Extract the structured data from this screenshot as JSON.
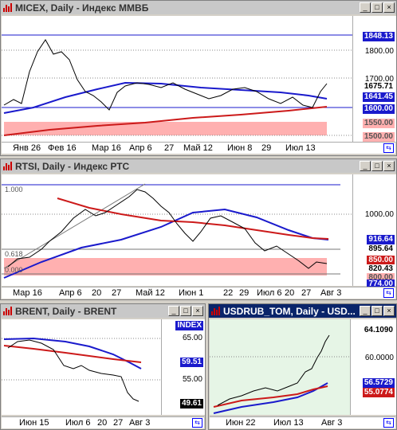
{
  "micex": {
    "title": "MICEX, Daily - Индекс ММВБ",
    "y_ticks": [
      "1800.00",
      "1700.00"
    ],
    "tags": [
      "1848.13",
      "1675.71",
      "1641.45",
      "1600.00",
      "1550.00",
      "1500.00"
    ],
    "x_ticks": [
      "Янв 26",
      "Фев 16",
      "Мар 16",
      "Апр 6",
      "27",
      "Май 12",
      "Июн 8",
      "29",
      "Июл 13"
    ]
  },
  "rtsi": {
    "title": "RTSI, Daily - Индекс РТС",
    "y_ticks": [
      "1000.00"
    ],
    "tags": [
      "916.64",
      "895.64",
      "850.00",
      "820.43",
      "800.00",
      "774.00"
    ],
    "fib": [
      "1.000",
      "0.618",
      "0.000"
    ],
    "x_ticks": [
      "Мар 16",
      "Апр 6",
      "20",
      "27",
      "Май 12",
      "Июн 1",
      "22",
      "29",
      "Июл 6",
      "20",
      "27",
      "Авг 3"
    ]
  },
  "brent": {
    "title": "BRENT, Daily - BRENT",
    "index_label": "INDEX",
    "y_ticks": [
      "65.00",
      "55.00"
    ],
    "tags": [
      "59.51",
      "49.61"
    ],
    "x_ticks": [
      "Июн 15",
      "Июл 6",
      "20",
      "27",
      "Авг 3"
    ]
  },
  "usdrub": {
    "title": "USDRUB_TOM, Daily - USD...",
    "y_ticks": [
      "60.0000"
    ],
    "tags": [
      "64.1090",
      "56.5729",
      "55.0774"
    ],
    "x_ticks": [
      "Июн 22",
      "Июл 13",
      "Авг 3"
    ]
  },
  "colors": {
    "ma_blue": "#1a1acc",
    "ma_red": "#cc1a1a",
    "zone": "#ffb0b0",
    "usd_bg": "#e6f5e6"
  }
}
